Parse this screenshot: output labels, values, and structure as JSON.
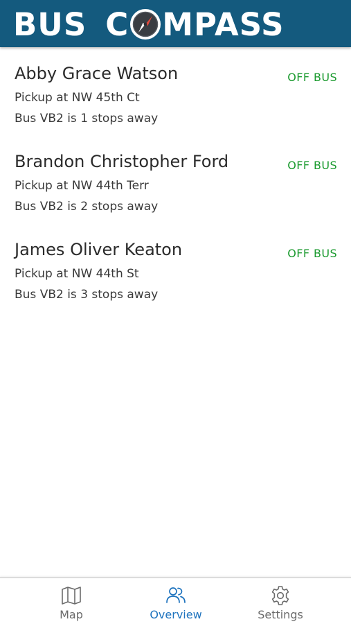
{
  "app": {
    "title_part1": "BUS",
    "title_part2_prefix": "C",
    "title_part2_suffix": "MPASS"
  },
  "colors": {
    "header_bg": "#145a7e",
    "status_off_bus": "#1a9a2e",
    "nav_active": "#1e73be",
    "nav_inactive": "#6a6a6a"
  },
  "students": [
    {
      "name": "Abby Grace Watson",
      "status": "OFF BUS",
      "pickup": "Pickup at NW 45th Ct",
      "eta": "Bus VB2 is 1 stops away"
    },
    {
      "name": "Brandon Christopher Ford",
      "status": "OFF BUS",
      "pickup": "Pickup at NW 44th Terr",
      "eta": "Bus VB2 is 2 stops away"
    },
    {
      "name": "James Oliver Keaton",
      "status": "OFF BUS",
      "pickup": "Pickup at NW 44th St",
      "eta": "Bus VB2 is 3 stops away"
    }
  ],
  "nav": {
    "items": [
      {
        "label": "Map",
        "icon": "map-icon",
        "active": false
      },
      {
        "label": "Overview",
        "icon": "users-icon",
        "active": true
      },
      {
        "label": "Settings",
        "icon": "gear-icon",
        "active": false
      }
    ]
  }
}
